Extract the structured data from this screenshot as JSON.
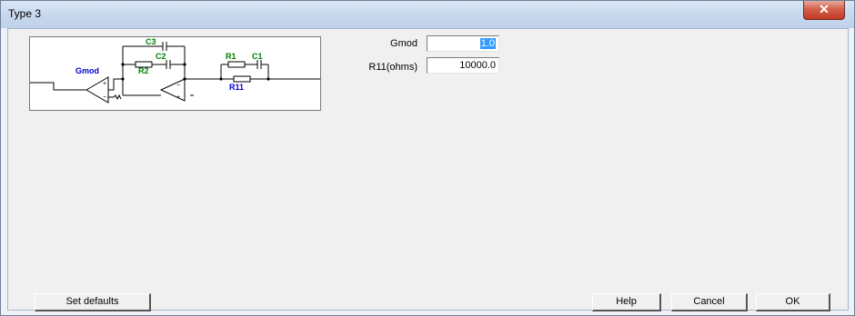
{
  "window": {
    "title": "Type 3",
    "close_glyph": "✕"
  },
  "schematic": {
    "labels": {
      "c3": "C3",
      "c2": "C2",
      "r2": "R2",
      "r1": "R1",
      "c1": "C1",
      "r11": "R11",
      "gmod": "Gmod"
    },
    "colors": {
      "green": "#008000",
      "blue": "#0000cc",
      "wire": "#000000"
    }
  },
  "fields": {
    "gmod": {
      "label": "Gmod",
      "value": "1.0"
    },
    "r11": {
      "label": "R11(ohms)",
      "value": "10000.0"
    }
  },
  "buttons": {
    "set_defaults": "Set defaults",
    "help": "Help",
    "cancel": "Cancel",
    "ok": "OK"
  }
}
